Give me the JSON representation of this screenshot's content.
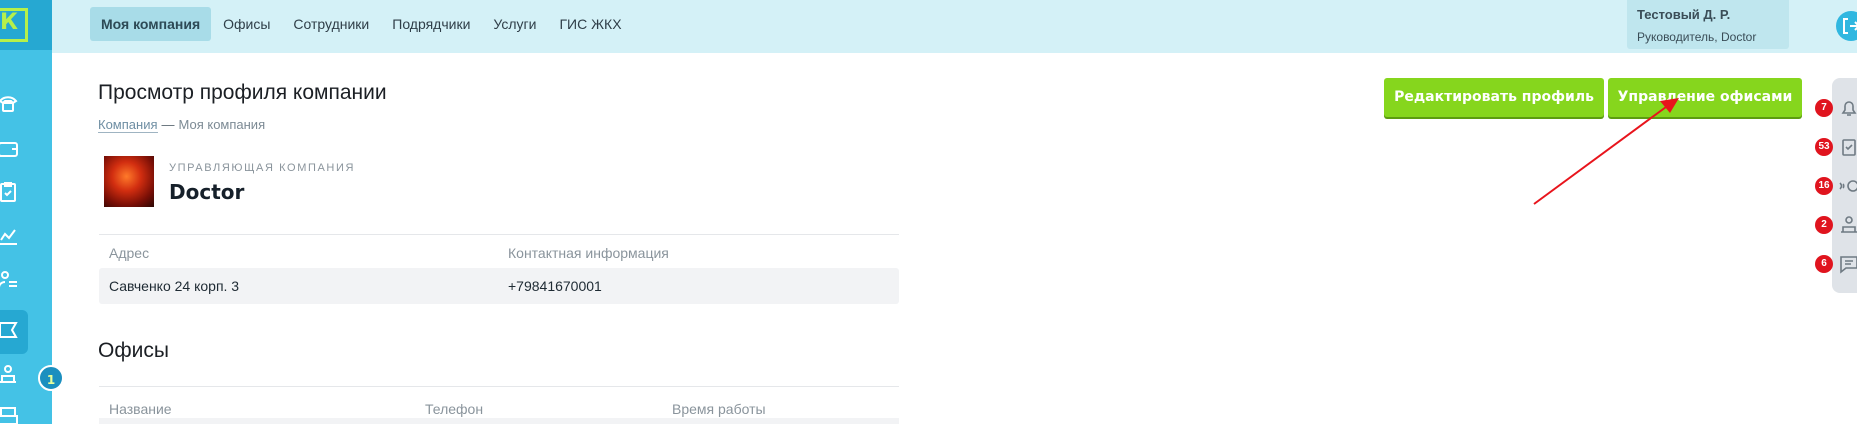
{
  "app": {
    "logo_letter": "К"
  },
  "nav": {
    "items": [
      {
        "label": "Моя компания",
        "active": true
      },
      {
        "label": "Офисы"
      },
      {
        "label": "Сотрудники"
      },
      {
        "label": "Подрядчики"
      },
      {
        "label": "Услуги"
      },
      {
        "label": "ГИС ЖКХ"
      }
    ]
  },
  "user": {
    "name": "Тестовый Д. Р.",
    "role": "Руководитель, Doctor"
  },
  "sidebar": {
    "icons": [
      "phone-icon",
      "wallet-icon",
      "clipboard-check-icon",
      "chart-icon",
      "users-tasks-icon",
      "ticket-icon",
      "worker-icon",
      "print-icon"
    ],
    "badge": "1"
  },
  "page": {
    "title": "Просмотр профиля компании",
    "breadcrumb": {
      "link": "Компания",
      "separator": "—",
      "current": "Моя компания"
    }
  },
  "actions": {
    "edit_profile": "Редактировать профиль",
    "manage_offices": "Управление офисами"
  },
  "company": {
    "kind": "УПРАВЛЯЮЩАЯ КОМПАНИЯ",
    "name": "Doctor"
  },
  "info_table": {
    "headers": [
      "Адрес",
      "Контактная информация"
    ],
    "row": [
      "Савченко 24 корп. 3",
      "+79841670001"
    ]
  },
  "offices": {
    "title": "Офисы",
    "headers": [
      "Название",
      "Телефон",
      "Время работы"
    ]
  },
  "right_rail": {
    "items": [
      {
        "icon": "bell-icon",
        "count": "7"
      },
      {
        "icon": "clipboard-check-icon",
        "count": "53"
      },
      {
        "icon": "call-icon",
        "count": "16"
      },
      {
        "icon": "worker-icon",
        "count": "2"
      },
      {
        "icon": "message-icon",
        "count": "6"
      }
    ]
  },
  "colors": {
    "sidebar": "#44c2e6",
    "topbar": "#d4f1f7",
    "accent_green": "#86d61d",
    "badge_red": "#e0141e",
    "annotation_arrow": "#e8141c"
  }
}
